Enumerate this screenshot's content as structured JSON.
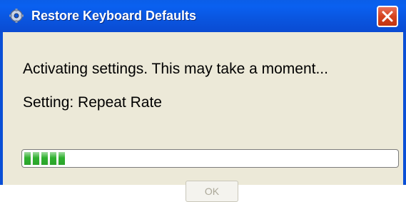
{
  "window": {
    "title": "Restore Keyboard Defaults",
    "icon": "keyboard-settings-icon",
    "close_icon": "close-icon"
  },
  "dialog": {
    "message": "Activating settings. This may take a moment...",
    "status": "Setting: Repeat Rate",
    "progress_fraction": 0.12,
    "ok_label": "OK",
    "ok_enabled": false
  },
  "colors": {
    "titlebar": "#0a55df",
    "client_background": "#ece9d8",
    "progress_fill": "#2fb12f",
    "close_button": "#d5431f"
  }
}
